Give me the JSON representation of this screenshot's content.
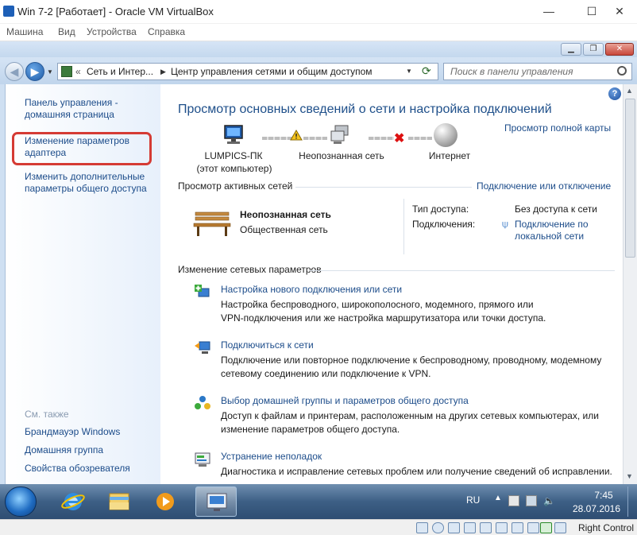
{
  "host_window": {
    "title": "Win 7-2 [Работает] - Oracle VM VirtualBox",
    "menu": [
      "Машина",
      "Вид",
      "Устройства",
      "Справка"
    ],
    "controls": {
      "minimize": "—",
      "maximize": "☐",
      "close": "✕"
    }
  },
  "explorer": {
    "window_controls": {
      "minimize": "▁",
      "restore": "❐",
      "close": "✕"
    },
    "breadcrumb": [
      "Сеть и Интер...",
      "Центр управления сетями и общим доступом"
    ],
    "search_placeholder": "Поиск в панели управления"
  },
  "sidebar": {
    "items": [
      {
        "label": "Панель управления - домашняя страница"
      },
      {
        "label": "Изменение параметров адаптера"
      },
      {
        "label": "Изменить дополнительные параметры общего доступа"
      }
    ],
    "see_also_label": "См. также",
    "see_also": [
      {
        "label": "Брандмауэр Windows"
      },
      {
        "label": "Домашняя группа"
      },
      {
        "label": "Свойства обозревателя"
      }
    ]
  },
  "main": {
    "title": "Просмотр основных сведений о сети и настройка подключений",
    "full_map_link": "Просмотр полной карты",
    "map": {
      "computer_name": "LUMPICS-ПК",
      "computer_sub": "(этот компьютер)",
      "network_name": "Неопознанная сеть",
      "internet": "Интернет"
    },
    "active_networks": {
      "heading": "Просмотр активных сетей",
      "connect_link": "Подключение или отключение",
      "network_name": "Неопознанная сеть",
      "network_type": "Общественная сеть",
      "access_type_label": "Тип доступа:",
      "access_type_value": "Без доступа к сети",
      "connections_label": "Подключения:",
      "connections_value": "Подключение по локальной сети"
    },
    "change_settings": {
      "heading": "Изменение сетевых параметров",
      "tasks": [
        {
          "icon": "new-connection-icon",
          "title": "Настройка нового подключения или сети",
          "desc_lines": [
            "Настройка беспроводного, широкополосного, модемного, прямого или",
            "VPN-подключения или же настройка маршрутизатора или точки доступа."
          ]
        },
        {
          "icon": "connect-to-network-icon",
          "title": "Подключиться к сети",
          "desc_lines": [
            "Подключение или повторное подключение к беспроводному, проводному, модемному",
            "сетевому соединению или подключение к VPN."
          ]
        },
        {
          "icon": "homegroup-icon",
          "title": "Выбор домашней группы и параметров общего доступа",
          "desc_lines": [
            "Доступ к файлам и принтерам, расположенным на других сетевых компьютерах, или",
            "изменение параметров общего доступа."
          ]
        },
        {
          "icon": "troubleshoot-icon",
          "title": "Устранение неполадок",
          "desc_lines": [
            "Диагностика и исправление сетевых проблем или получение сведений об исправлении."
          ]
        }
      ]
    }
  },
  "taskbar": {
    "language": "RU",
    "time": "7:45",
    "date": "28.07.2016",
    "apps": [
      "internet-explorer-icon",
      "file-explorer-icon",
      "media-player-icon",
      "network-center-icon"
    ]
  },
  "status_bar": {
    "host_key_label": "Right Control"
  },
  "colors": {
    "link": "#1c4c8a",
    "title": "#1e4f8a",
    "highlight": "#d53b34"
  }
}
